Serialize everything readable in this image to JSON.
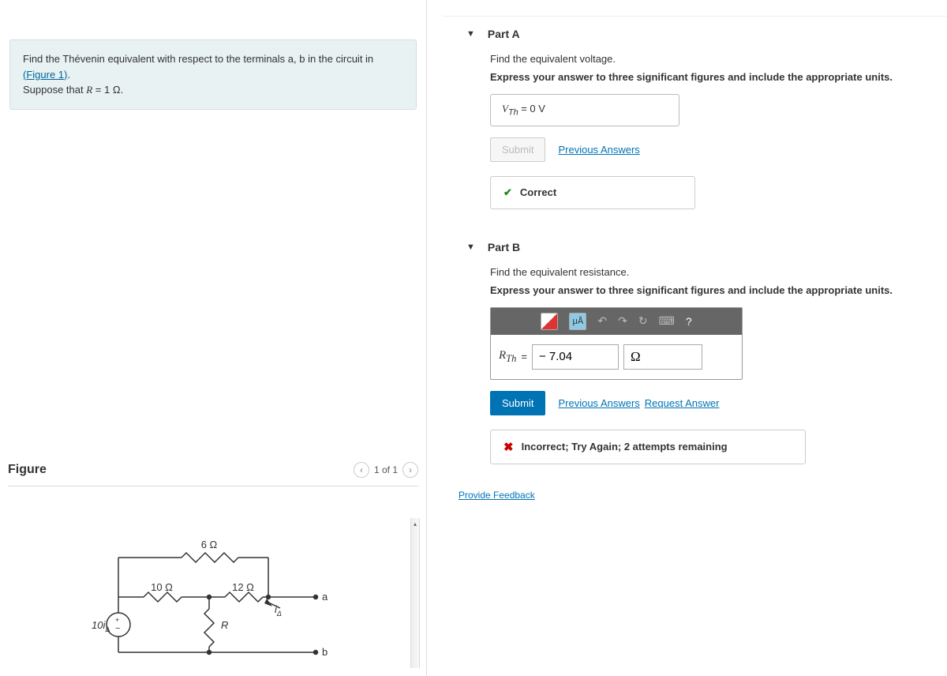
{
  "problem": {
    "text_prefix": "Find the Thévenin equivalent with respect to the terminals a, b in the circuit in ",
    "figure_link": "(Figure 1)",
    "text_suffix": ".",
    "suppose_prefix": "Suppose that ",
    "suppose_var": "R",
    "suppose_eq": " = 1 Ω."
  },
  "figure": {
    "title": "Figure",
    "pager": "1 of 1",
    "labels": {
      "r6": "6 Ω",
      "r10": "10 Ω",
      "r12": "12 Ω",
      "rR": "R",
      "src": "10i",
      "src_sub": "Δ",
      "is": "i",
      "is_sub": "Δ",
      "a": "a",
      "b": "b"
    }
  },
  "partA": {
    "title": "Part A",
    "instr1": "Find the equivalent voltage.",
    "instr2": "Express your answer to three significant figures and include the appropriate units.",
    "answer_var": "V",
    "answer_sub": "Th",
    "answer_val": " = 0 V",
    "submit": "Submit",
    "prev": "Previous Answers",
    "feedback": "Correct"
  },
  "partB": {
    "title": "Part B",
    "instr1": "Find the equivalent resistance.",
    "instr2": "Express your answer to three significant figures and include the appropriate units.",
    "rth_var": "R",
    "rth_sub": "Th",
    "rth_eq": " = ",
    "value": "− 7.04",
    "unit": "Ω",
    "submit": "Submit",
    "prev": "Previous Answers",
    "req": "Request Answer",
    "feedback": "Incorrect; Try Again; 2 attempts remaining",
    "toolbar": {
      "ua": "μÅ",
      "q": "?"
    }
  },
  "feedback_link": "Provide Feedback"
}
